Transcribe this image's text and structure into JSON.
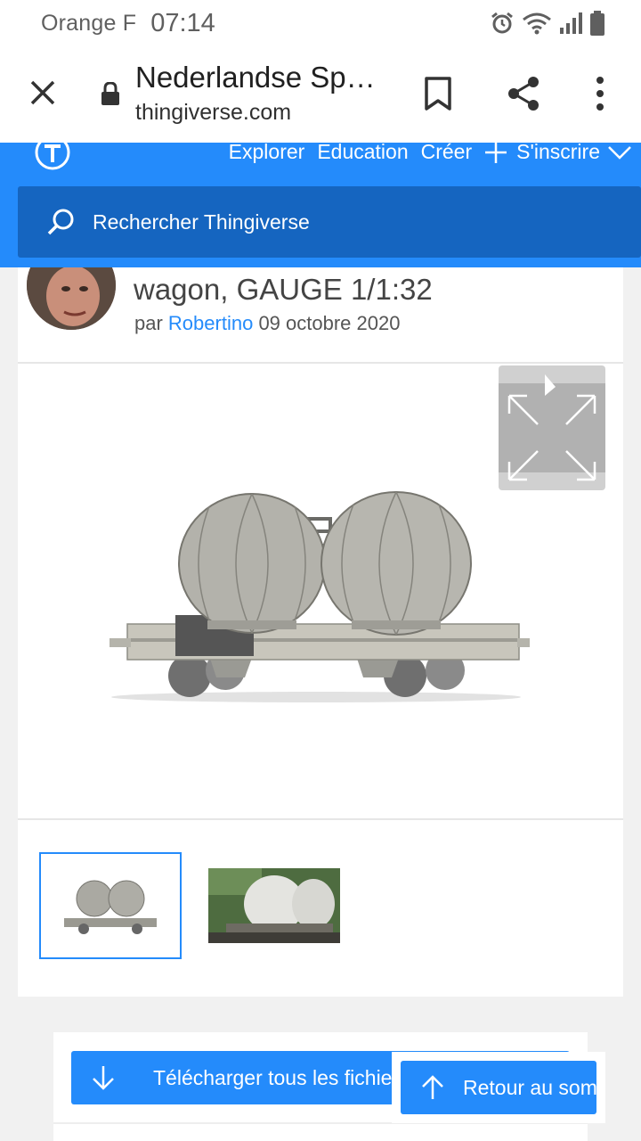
{
  "status_bar": {
    "carrier": "Orange F",
    "time": "07:14",
    "icons": [
      "alarm-icon",
      "wifi-icon",
      "signal-icon",
      "battery-icon"
    ]
  },
  "browser": {
    "page_title": "Nederlandse Sp…",
    "domain": "thingiverse.com",
    "icons": [
      "close-icon",
      "lock-icon",
      "bookmark-icon",
      "share-icon",
      "more-vert-icon"
    ]
  },
  "site_header": {
    "nav": {
      "explore": "Explorer",
      "education": "Education",
      "create": "Créer",
      "signup": "S'inscrire"
    },
    "search_placeholder": "Rechercher Thingiverse",
    "brand_color": "#248bfb",
    "search_bg": "#1565c0"
  },
  "thing": {
    "title_visible": "wagon, GAUGE 1/1:32",
    "byline_prefix": "par",
    "author": "Robertino",
    "date": "09 octobre 2020"
  },
  "gallery": {
    "thumbnails": [
      "render-thumbnail",
      "photo-thumbnail"
    ],
    "selected_index": 0
  },
  "actions": {
    "download_all": "Télécharger tous les fichiers",
    "back_to_top": "Retour au sommet"
  }
}
